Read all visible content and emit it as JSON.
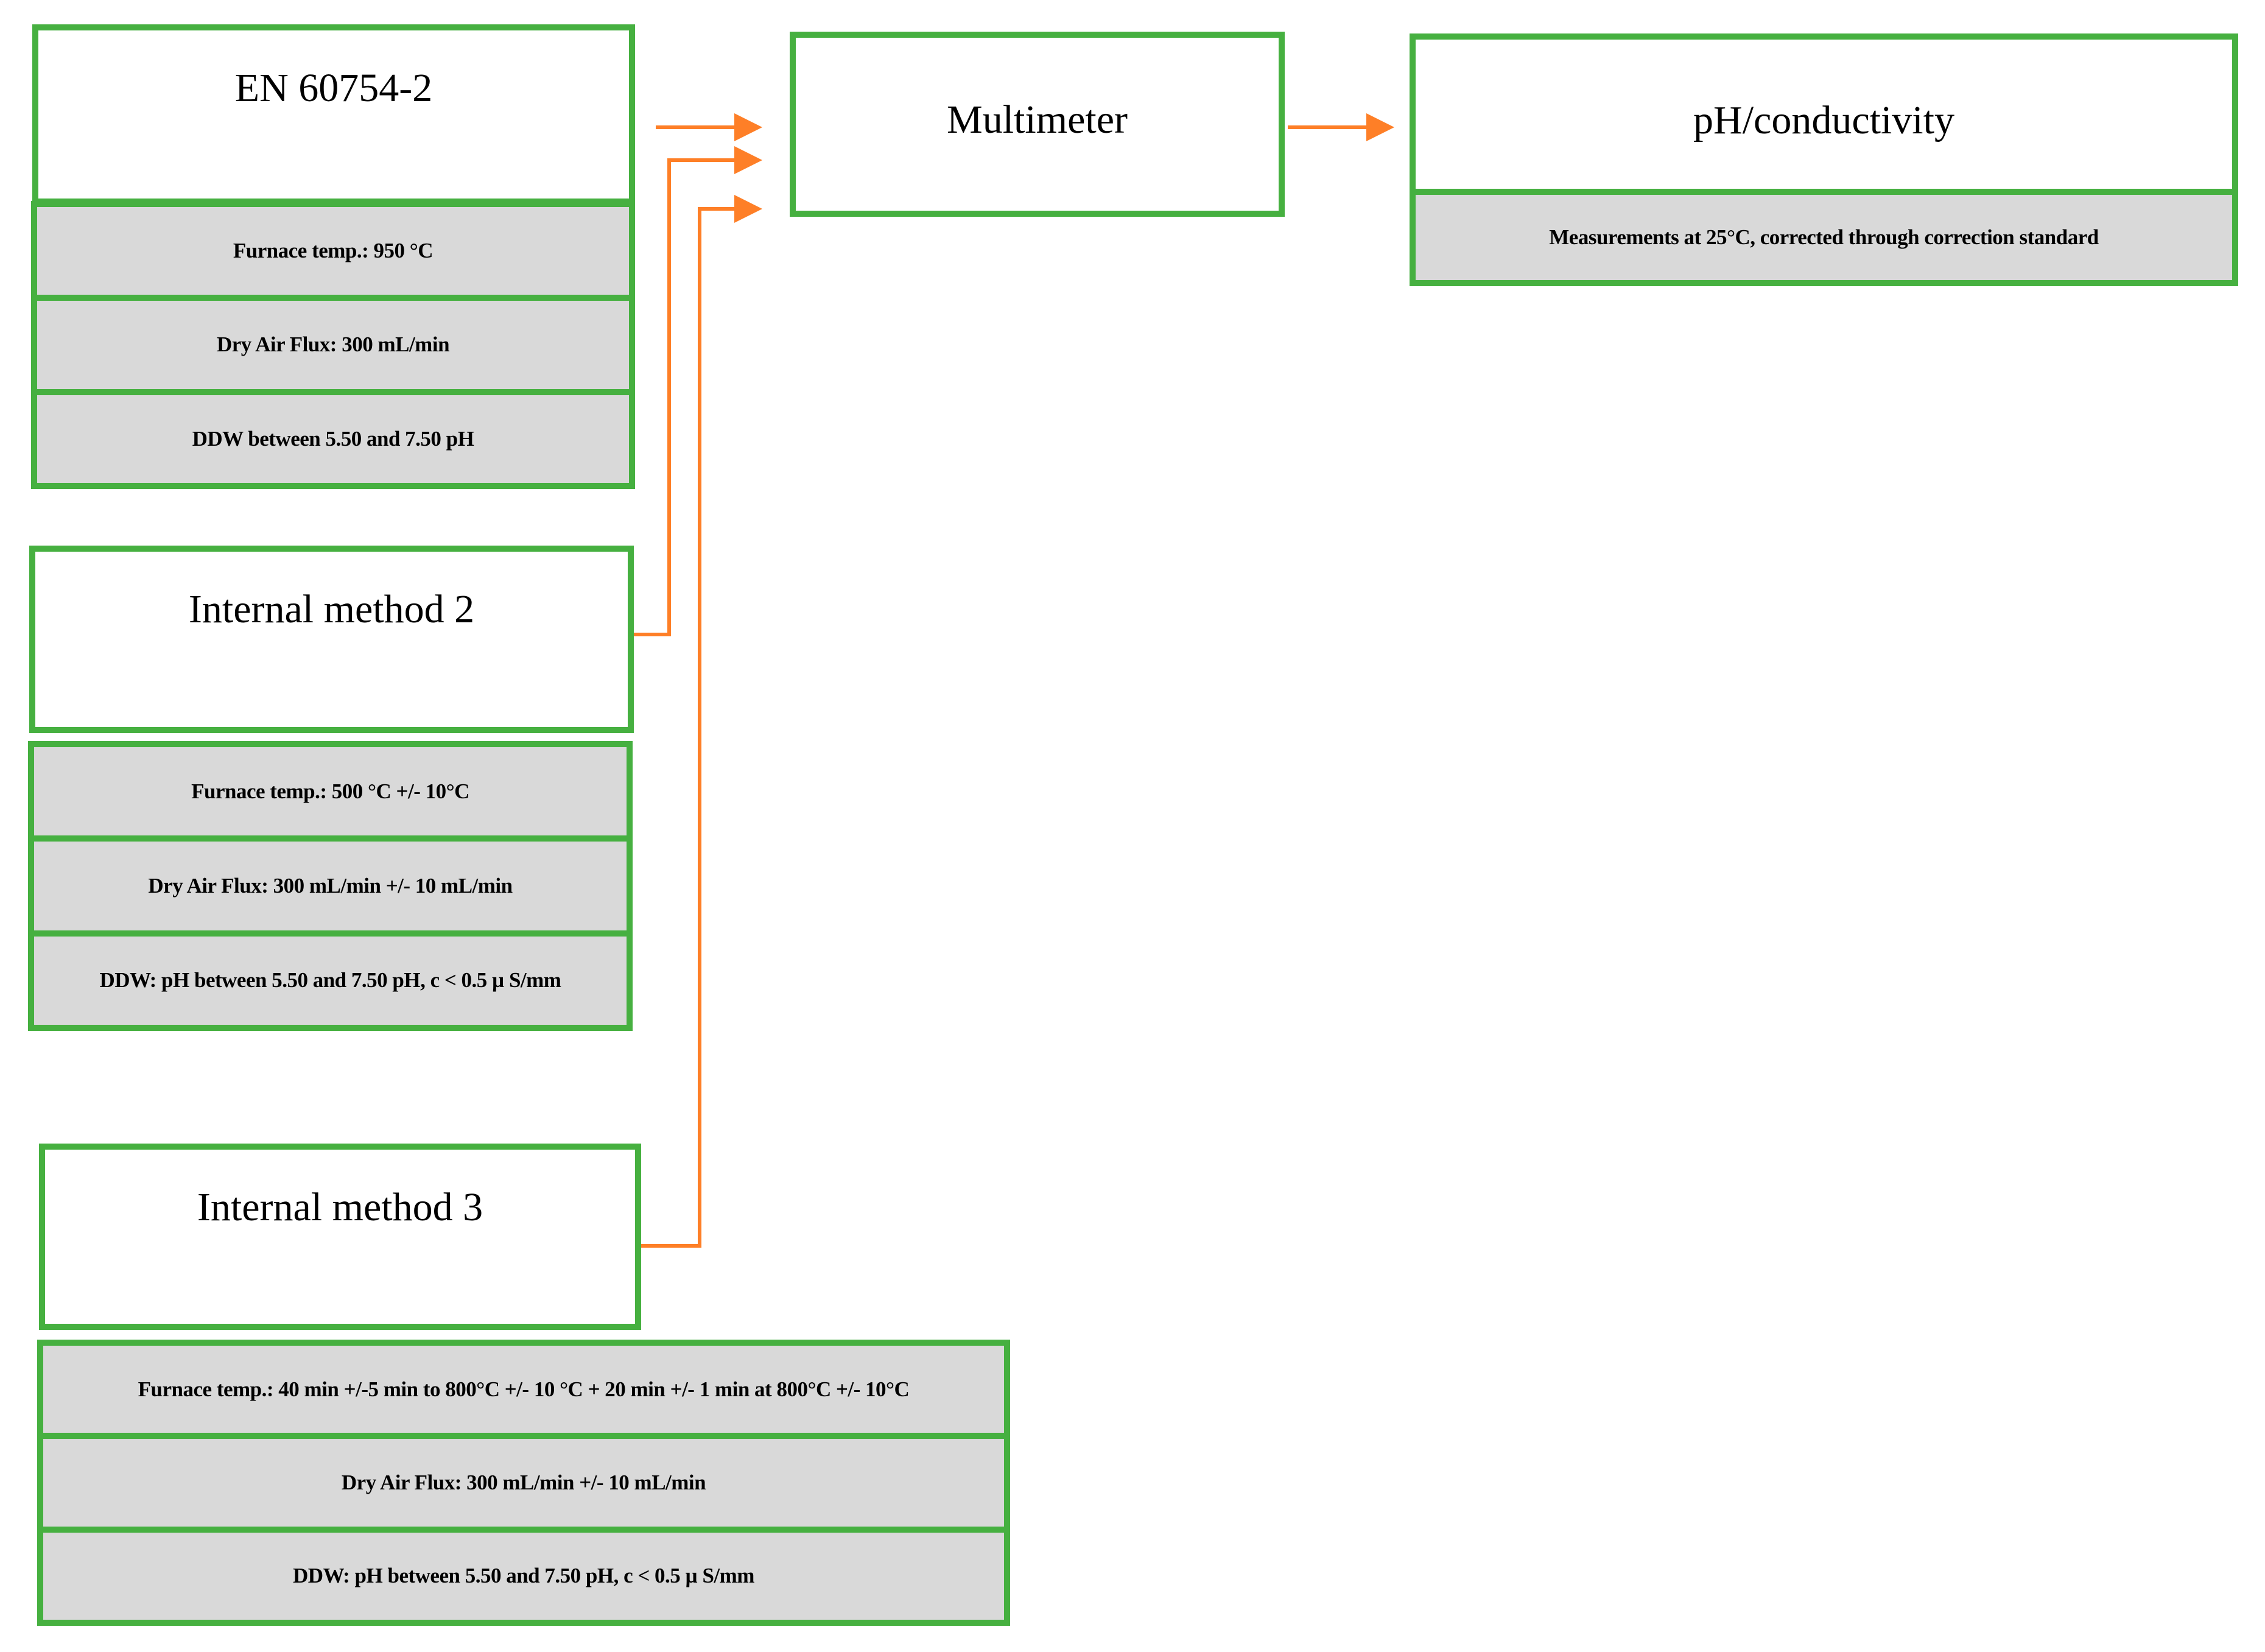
{
  "colors": {
    "box_border": "#46b040",
    "param_fill": "#d9d9d9",
    "arrow": "#fe7f27"
  },
  "nodes": {
    "en_60754_2": {
      "title": "EN 60754-2",
      "params": [
        "Furnace temp.: 950 °C",
        "Dry Air Flux: 300 mL/min",
        "DDW between 5.50 and 7.50 pH"
      ]
    },
    "internal_method_2": {
      "title": "Internal method 2",
      "params": [
        "Furnace temp.: 500 °C +/- 10°C",
        "Dry Air Flux: 300 mL/min +/- 10 mL/min",
        "DDW: pH between 5.50 and 7.50 pH, c < 0.5 µ S/mm"
      ]
    },
    "internal_method_3": {
      "title": "Internal method 3",
      "params": [
        "Furnace temp.: 40 min +/-5 min to 800°C +/- 10 °C + 20 min +/- 1 min at 800°C +/- 10°C",
        "Dry Air Flux: 300 mL/min +/- 10 mL/min",
        "DDW: pH between 5.50 and 7.50 pH, c < 0.5 µ S/mm"
      ]
    },
    "multimeter": {
      "title": "Multimeter"
    },
    "ph_conductivity": {
      "title": "pH/conductivity",
      "params": [
        "Measurements at 25°C, corrected through correction standard"
      ]
    }
  },
  "edges": [
    {
      "from": "EN 60754-2",
      "to": "Multimeter"
    },
    {
      "from": "Internal method 2",
      "to": "Multimeter"
    },
    {
      "from": "Internal method 3",
      "to": "Multimeter"
    },
    {
      "from": "Multimeter",
      "to": "pH/conductivity"
    }
  ]
}
